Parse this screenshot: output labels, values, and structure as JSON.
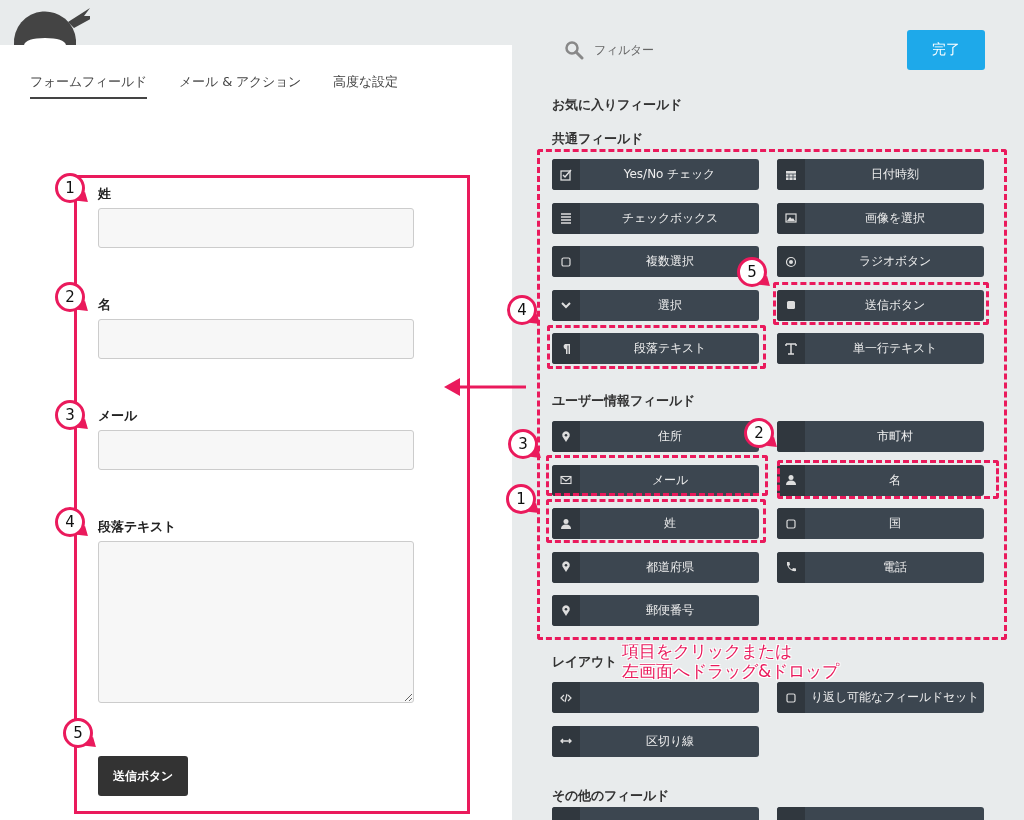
{
  "tabs": [
    {
      "label": "フォームフィールド",
      "selected": true
    },
    {
      "label": "メール & アクション",
      "selected": false
    },
    {
      "label": "高度な設定",
      "selected": false
    }
  ],
  "form_fields": [
    {
      "kind": "text",
      "label": "姓"
    },
    {
      "kind": "text",
      "label": "名"
    },
    {
      "kind": "text",
      "label": "メール"
    },
    {
      "kind": "textarea",
      "label": "段落テキスト"
    },
    {
      "kind": "submit",
      "button": "送信ボタン"
    }
  ],
  "filter": {
    "placeholder": "フィルター"
  },
  "done_button": "完了",
  "favorites": {
    "title": "お気に入りフィールド"
  },
  "sections": [
    {
      "title": "共通フィールド",
      "items": [
        {
          "kind": "labeled",
          "label": "Yes/No チェック"
        },
        {
          "kind": "labeled",
          "label": "日付時刻"
        },
        {
          "kind": "labeled",
          "label": "チェックボックス"
        },
        {
          "kind": "labeled",
          "label": "画像を選択"
        },
        {
          "kind": "labeled",
          "label": "複数選択"
        },
        {
          "kind": "labeled",
          "label": "ラジオボタン"
        },
        {
          "kind": "labeled",
          "label": "選択"
        },
        {
          "kind": "labeled",
          "label": "送信ボタン"
        },
        {
          "kind": "labeled",
          "label": "段落テキスト"
        },
        {
          "kind": "labeled",
          "label": "単一行テキスト"
        }
      ]
    },
    {
      "title": "ユーザー情報フィールド",
      "items": [
        {
          "kind": "labeled",
          "label": "住所"
        },
        {
          "kind": "labeled",
          "label": "市町村"
        },
        {
          "kind": "labeled",
          "label": "メール"
        },
        {
          "kind": "labeled",
          "label": "名"
        },
        {
          "kind": "labeled",
          "label": "姓"
        },
        {
          "kind": "labeled",
          "label": "国"
        },
        {
          "kind": "labeled",
          "label": "都道府県"
        },
        {
          "kind": "labeled",
          "label": "電話"
        },
        {
          "kind": "labeled",
          "label": "郵便番号"
        }
      ]
    },
    {
      "title": "レイアウト",
      "items": [
        {
          "kind": "unlabeled"
        },
        {
          "kind": "labeled",
          "label": "り返し可能なフィールドセット"
        },
        {
          "kind": "labeled",
          "label": "区切り線"
        }
      ]
    },
    {
      "title": "その他のフィールド",
      "items": [
        {
          "kind": "unlabeled"
        },
        {
          "kind": "unlabeled"
        }
      ]
    }
  ],
  "annotations": {
    "left_markers": [
      "1",
      "2",
      "3",
      "4",
      "5"
    ],
    "right_markers": [
      "5",
      "4",
      "3",
      "2",
      "1"
    ],
    "note": [
      "項目をクリックまたは",
      "左画面へドラッグ&ドロップ"
    ]
  }
}
